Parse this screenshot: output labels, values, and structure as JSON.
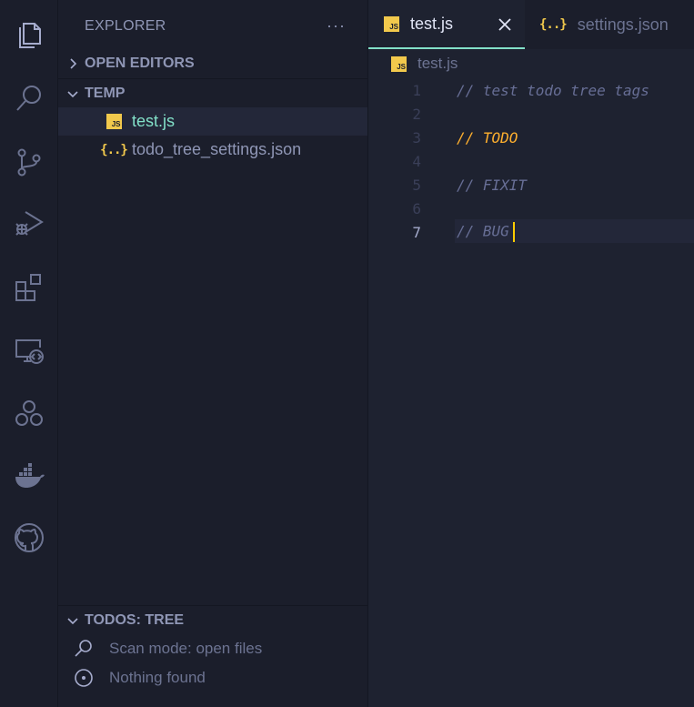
{
  "sidebar": {
    "title": "EXPLORER",
    "more": "···",
    "open_editors": "OPEN EDITORS",
    "folder": "TEMP",
    "files": [
      {
        "name": "test.js",
        "type": "js",
        "selected": true
      },
      {
        "name": "todo_tree_settings.json",
        "type": "json",
        "selected": false
      }
    ],
    "todos": {
      "header": "TODOS: TREE",
      "items": [
        {
          "icon": "search-icon",
          "label": "Scan mode: open files"
        },
        {
          "icon": "info-icon",
          "label": "Nothing found"
        }
      ]
    }
  },
  "editor": {
    "tabs": [
      {
        "label": "test.js",
        "type": "js",
        "active": true
      },
      {
        "label": "settings.json",
        "type": "json",
        "active": false
      }
    ],
    "breadcrumb": "test.js",
    "lines": [
      {
        "n": "1",
        "text": "// test todo tree tags"
      },
      {
        "n": "2",
        "text": ""
      },
      {
        "n": "3",
        "text": "// TODO"
      },
      {
        "n": "4",
        "text": ""
      },
      {
        "n": "5",
        "text": "// FIXIT"
      },
      {
        "n": "6",
        "text": ""
      },
      {
        "n": "7",
        "text": "// BUG"
      }
    ],
    "current_line": "7"
  },
  "badges": {
    "js": "JS",
    "json": "{..}"
  },
  "colors": {
    "accent": "#82e0c8",
    "todo": "#ffb02e",
    "cursor": "#ffcc00",
    "json_icon": "#f2c94c"
  }
}
